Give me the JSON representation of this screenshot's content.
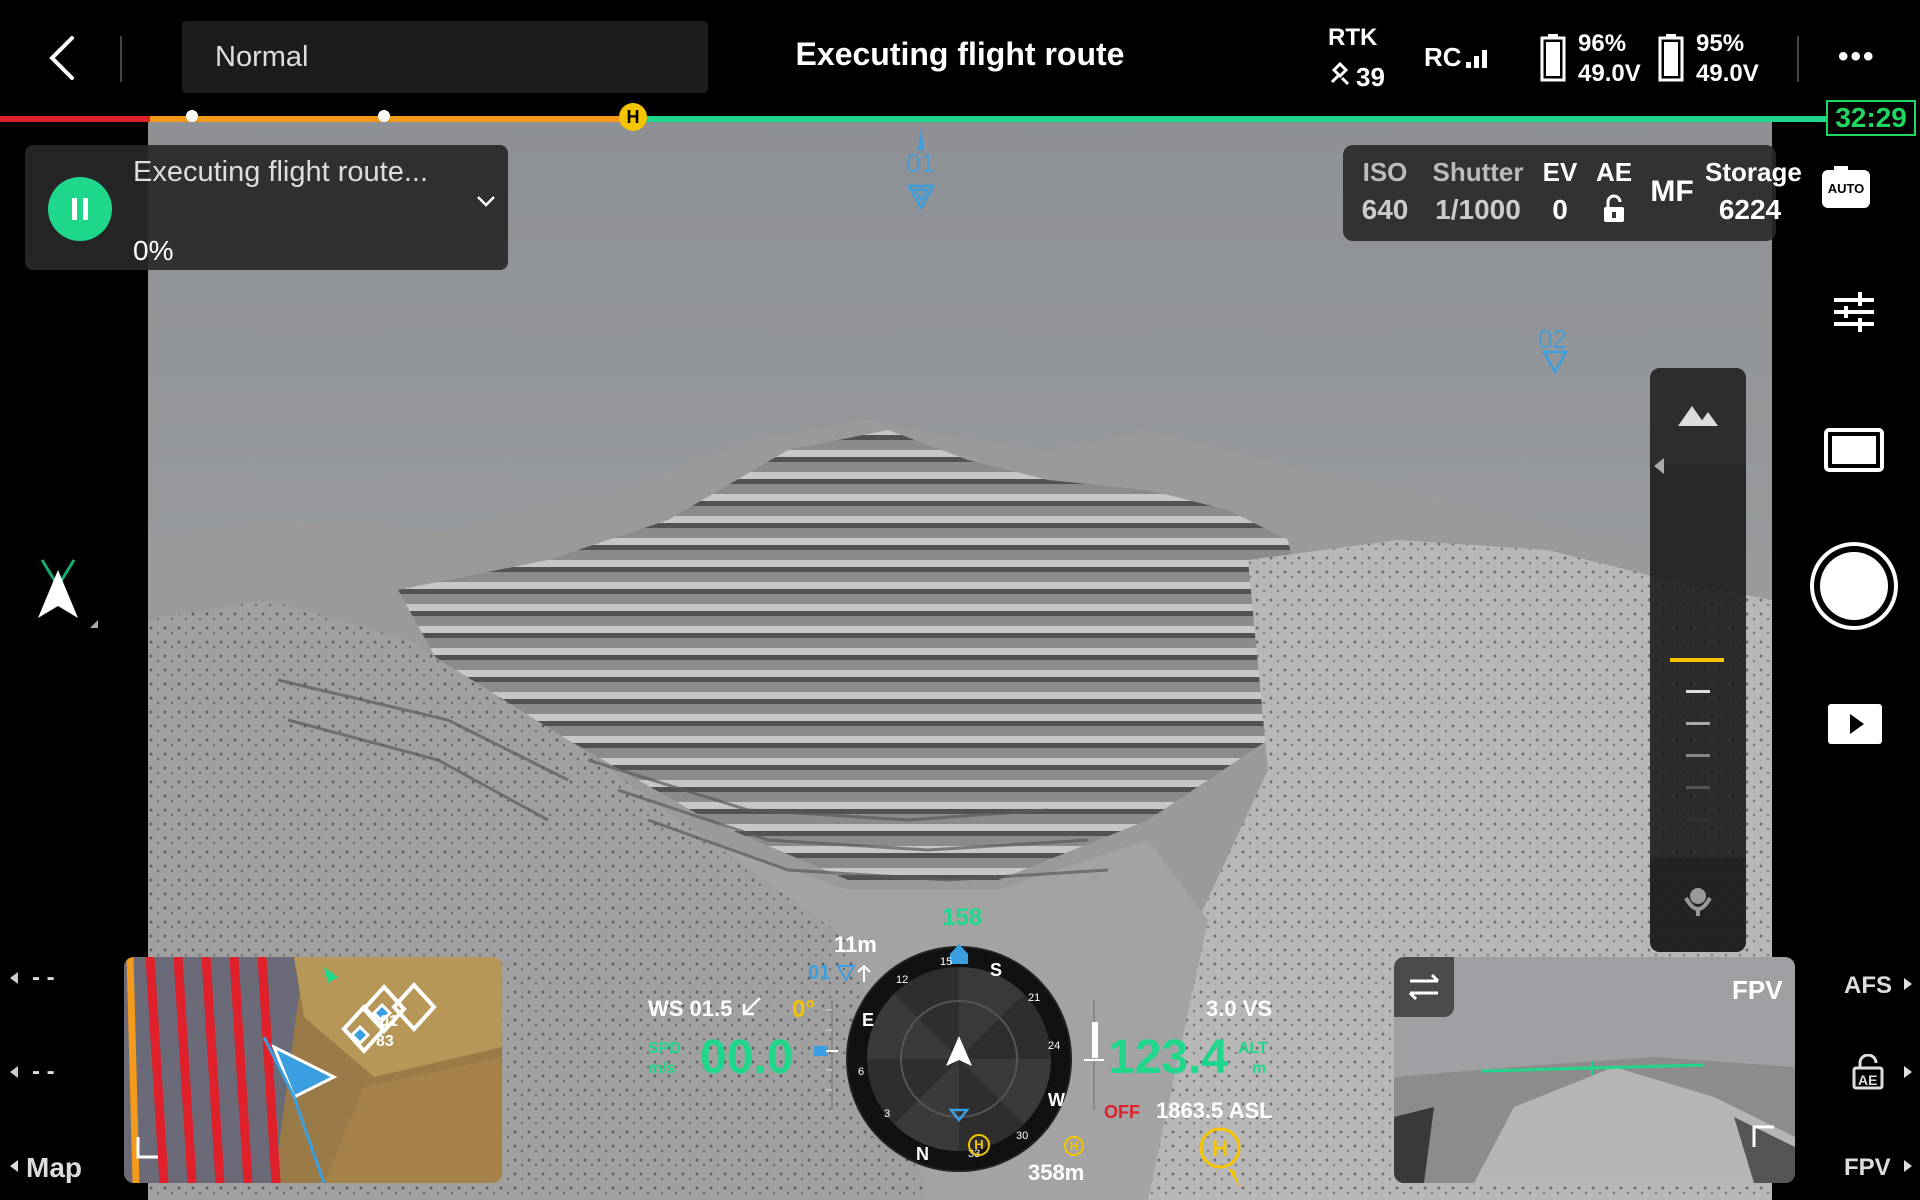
{
  "header": {
    "mode": "Normal",
    "title": "Executing flight route",
    "rtk_label": "RTK",
    "rtk_count": "39",
    "rc_label": "RC",
    "battery1_percent": "96%",
    "battery1_voltage": "49.0V",
    "battery2_percent": "95%",
    "battery2_voltage": "49.0V",
    "more": "•••"
  },
  "timeline": {
    "remaining_time": "32:29",
    "home_marker": "H"
  },
  "task": {
    "status": "Executing flight route...",
    "progress": "0%"
  },
  "camera_params": {
    "iso_label": "ISO",
    "iso_value": "640",
    "shutter_label": "Shutter",
    "shutter_value": "1/1000",
    "ev_label": "EV",
    "ev_value": "0",
    "ae_label": "AE",
    "focus_mode": "MF",
    "storage_label": "Storage",
    "storage_value": "6224",
    "auto_badge": "AUTO"
  },
  "waypoints": {
    "wp1": "01",
    "wp2": "02"
  },
  "left_rail": {
    "item1": "- -",
    "item2": "- -",
    "map_label": "Map"
  },
  "right_rail": {
    "afs_label": "AFS",
    "ae_label": "AE",
    "fpv_label": "FPV"
  },
  "fpv": {
    "label": "FPV"
  },
  "telemetry": {
    "heading": "158",
    "distance_to_wp": "11m",
    "wp_label": "01",
    "wind": "WS 01.5",
    "gimbal_pitch": "0°",
    "spd_label": "SPD",
    "spd_unit": "m/s",
    "speed": "00.0",
    "vs": "3.0 VS",
    "altitude": "123.4",
    "alt_label": "ALT",
    "alt_unit": "m",
    "obstacle": "OFF",
    "asl": "1863.5 ASL",
    "home_distance": "358m",
    "compass_n": "N",
    "compass_e": "E",
    "compass_s": "S",
    "compass_w": "W",
    "tick_3": "3",
    "tick_6": "6",
    "tick_12": "12",
    "tick_15": "15",
    "tick_21": "21",
    "tick_24": "24",
    "tick_30": "30",
    "tick_33": "33"
  },
  "minimap": {
    "label_a": "01",
    "label_b": "83"
  },
  "colors": {
    "accent_green": "#1ed78a",
    "waypoint_blue": "#3a9fe0",
    "home_yellow": "#f5c400",
    "route_red": "#e0202a",
    "route_orange": "#f39a1b"
  }
}
